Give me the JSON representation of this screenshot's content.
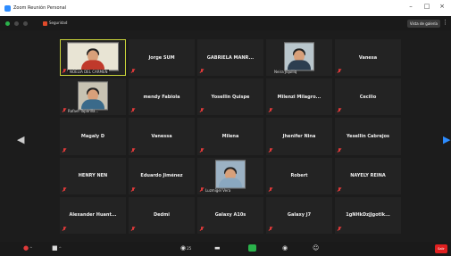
{
  "window": {
    "title": "Zoom Reunión  Personal",
    "minimize_icon": "minimize-icon",
    "maximize_icon": "maximize-icon",
    "close_icon": "close-icon"
  },
  "meeting_bar": {
    "security_label": "Seguridad",
    "view_button_label": "Vista de galería"
  },
  "participants": [
    {
      "name": "",
      "caption": "NOELIA DEL CARMEN",
      "video": true,
      "active": true,
      "muted": true,
      "shirt": "#c0392b",
      "bg": "#e8e4d4"
    },
    {
      "name": "Jorge SUM",
      "caption": "",
      "video": false,
      "muted": true
    },
    {
      "name": "GABRIELA MANR...",
      "caption": "",
      "video": false,
      "muted": true
    },
    {
      "name": "",
      "caption": "Neira Jiquiliq",
      "video": true,
      "muted": false,
      "shirt": "#2c3e50",
      "bg": "#b9c6cc"
    },
    {
      "name": "Vanesa",
      "caption": "",
      "video": false,
      "muted": true
    },
    {
      "name": "",
      "caption": "Rafael Taparilla...",
      "video": true,
      "muted": true,
      "shirt": "#3a6a8a",
      "bg": "#c7c2b2"
    },
    {
      "name": "mendy Fabiola",
      "caption": "",
      "video": false,
      "muted": true
    },
    {
      "name": "Yosellin Quispe",
      "caption": "",
      "video": false,
      "muted": true
    },
    {
      "name": "Milenzi  Milagro...",
      "caption": "",
      "video": false,
      "muted": true
    },
    {
      "name": "Cecilio",
      "caption": "",
      "video": false,
      "muted": true
    },
    {
      "name": "Magaly D",
      "caption": "",
      "video": false,
      "muted": true
    },
    {
      "name": "Vanessa",
      "caption": "",
      "video": false,
      "muted": true
    },
    {
      "name": "Milena",
      "caption": "",
      "video": false,
      "muted": true
    },
    {
      "name": "Jhenifer Nina",
      "caption": "",
      "video": false,
      "muted": true
    },
    {
      "name": "Yesellin Cabrejos",
      "caption": "",
      "video": false,
      "muted": true
    },
    {
      "name": "HENRY NEN",
      "caption": "",
      "video": false,
      "muted": true
    },
    {
      "name": "Eduardo Jiménez",
      "caption": "",
      "video": false,
      "muted": true
    },
    {
      "name": "",
      "caption": "Luzmigel Vera",
      "video": true,
      "muted": true,
      "shirt": "#8aa8c0",
      "bg": "#9cb2c4"
    },
    {
      "name": "Robert",
      "caption": "",
      "video": false,
      "muted": true
    },
    {
      "name": "NAYELY REINA",
      "caption": "",
      "video": false,
      "muted": true
    },
    {
      "name": "Alexander Huant...",
      "caption": "",
      "video": false,
      "muted": true
    },
    {
      "name": "Dedmi",
      "caption": "",
      "video": false,
      "muted": true
    },
    {
      "name": "Galaxy A10s",
      "caption": "",
      "video": false,
      "muted": true
    },
    {
      "name": "Galaxy J7",
      "caption": "",
      "video": false,
      "muted": true
    },
    {
      "name": "1gNHkDzjJgotlk...",
      "caption": "",
      "video": false,
      "muted": true
    }
  ],
  "toolbar": {
    "participants_count": "25",
    "leave_label": "Salir"
  },
  "colors": {
    "background": "#1c1c1c",
    "tile": "#232323",
    "active_border": "#c9d33a",
    "muted_red": "#e03a3a",
    "nav_arrow_right": "#2d8cff",
    "leave_red": "#e02020"
  }
}
